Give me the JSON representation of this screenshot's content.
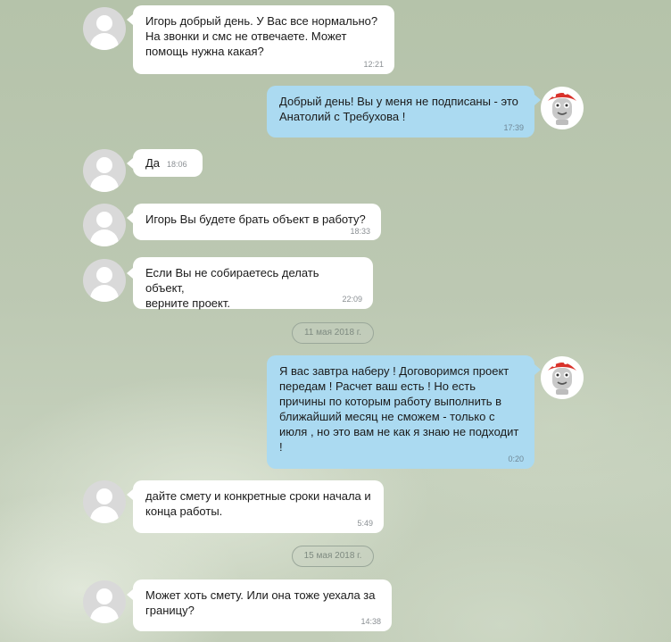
{
  "chat": {
    "messages": [
      {
        "text": "Игорь добрый день. У Вас все нормально?\nНа звонки и смс не отвечаете. Может\nпомощь нужна какая?",
        "time": "12:21"
      },
      {
        "text": "Добрый день! Вы у меня не подписаны - это\nАнатолий с Требухова !",
        "time": "17:39"
      },
      {
        "text": "Да",
        "time": "18:06"
      },
      {
        "text": "Игорь Вы будете брать объект в работу?",
        "time": "18:33"
      },
      {
        "text": "Если Вы не собираетесь делать объект,\nверните проект.",
        "time": "22:09"
      },
      {
        "text": "Я вас завтра наберу ! Договоримся проект\nпередам ! Расчет ваш есть ! Но есть\nпричины по которым работу выполнить  в\nближайший месяц не сможем - только с\nиюля , но это вам не как я знаю не подходит\n!",
        "time": "0:20"
      },
      {
        "text": "дайте смету и конкретные сроки начала и\nконца работы.",
        "time": "5:49"
      },
      {
        "text": "Может хоть смету. Или она тоже уехала за\nграницу?",
        "time": "14:38"
      }
    ],
    "dates": [
      "11 мая 2018 г.",
      "15 мая 2018 г."
    ]
  },
  "icons": {
    "contact_avatar": "default-user-avatar-icon",
    "own_avatar": "red-cap-robot-avatar-icon"
  },
  "colors": {
    "incoming_bubble": "#ffffff",
    "outgoing_bubble": "#abdaf1",
    "background": "#b6c3ac"
  }
}
